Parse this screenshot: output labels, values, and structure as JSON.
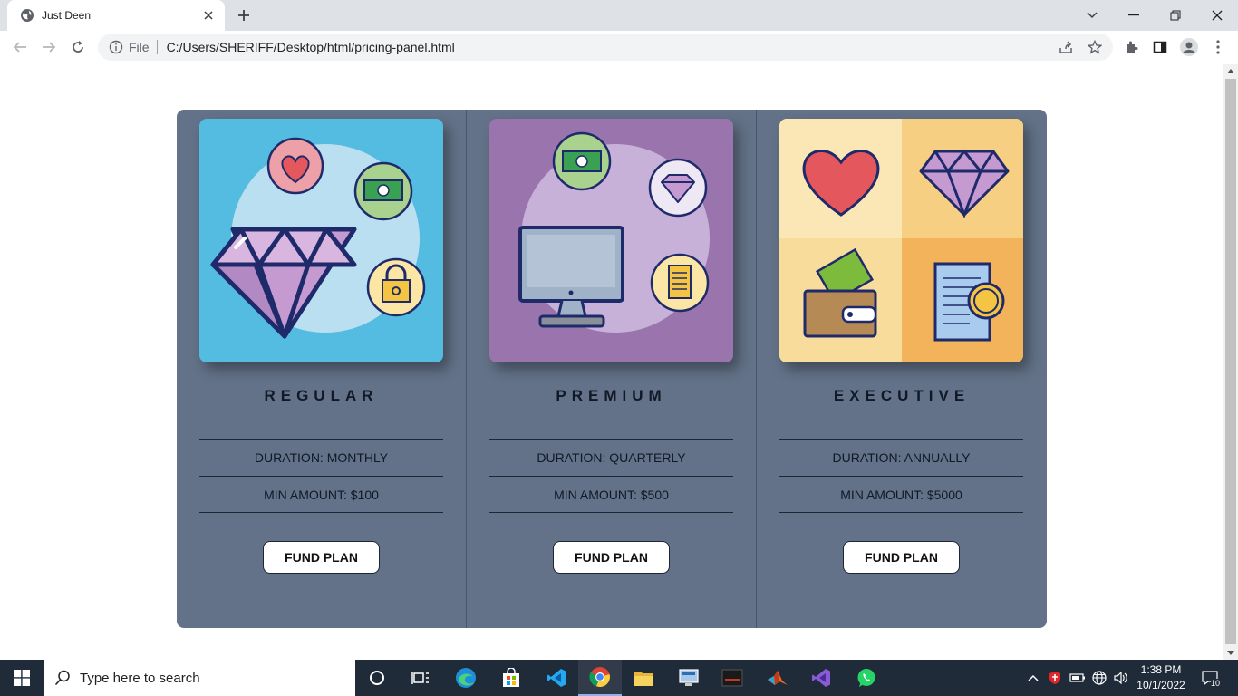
{
  "browser": {
    "tab_title": "Just Deen",
    "scheme": "File",
    "url": "C:/Users/SHERIFF/Desktop/html/pricing-panel.html"
  },
  "plans": [
    {
      "name": "REGULAR",
      "duration": "DURATION: MONTHLY",
      "min_amount": "MIN AMOUNT: $100",
      "button": "FUND PLAN",
      "bg": "#53bce0"
    },
    {
      "name": "PREMIUM",
      "duration": "DURATION: QUARTERLY",
      "min_amount": "MIN AMOUNT: $500",
      "button": "FUND PLAN",
      "bg": "#9a74ad"
    },
    {
      "name": "EXECUTIVE",
      "duration": "DURATION: ANNUALLY",
      "min_amount": "MIN AMOUNT: $5000",
      "button": "FUND PLAN",
      "bg": "#f7c97e"
    }
  ],
  "colors": {
    "panel": "#637288",
    "taskbar": "#202b3a",
    "tabbar": "#dee1e6"
  },
  "taskbar": {
    "search_placeholder": "Type here to search",
    "time": "1:38 PM",
    "date": "10/1/2022",
    "notification_count": "10"
  }
}
